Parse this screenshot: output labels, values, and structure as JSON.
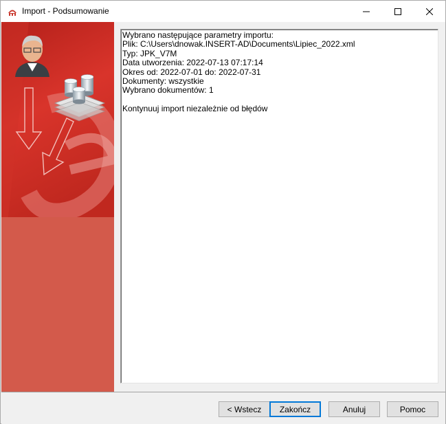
{
  "window": {
    "title": "Import - Podsumowanie"
  },
  "summary": {
    "lines": [
      "Wybrano następujące parametry importu:",
      "Plik: C:\\Users\\dnowak.INSERT-AD\\Documents\\Lipiec_2022.xml",
      "Typ: JPK_V7M",
      "Data utworzenia: 2022-07-13 07:17:14",
      "Okres od: 2022-07-01 do: 2022-07-31",
      "Dokumenty: wszystkie",
      "Wybrano dokumentów: 1",
      "",
      "Kontynuuj import niezależnie od błędów"
    ]
  },
  "buttons": {
    "back": "< Wstecz",
    "finish": "Zakończ",
    "cancel": "Anuluj",
    "help": "Pomoc"
  },
  "icons": {
    "app": "app-logo-icon",
    "minimize": "minimize-icon",
    "maximize": "maximize-icon",
    "close": "close-icon",
    "user": "user-avatar-icon",
    "database": "database-stack-icon"
  },
  "colors": {
    "sidebar": "#d35a4b",
    "focus": "#0078d7"
  }
}
